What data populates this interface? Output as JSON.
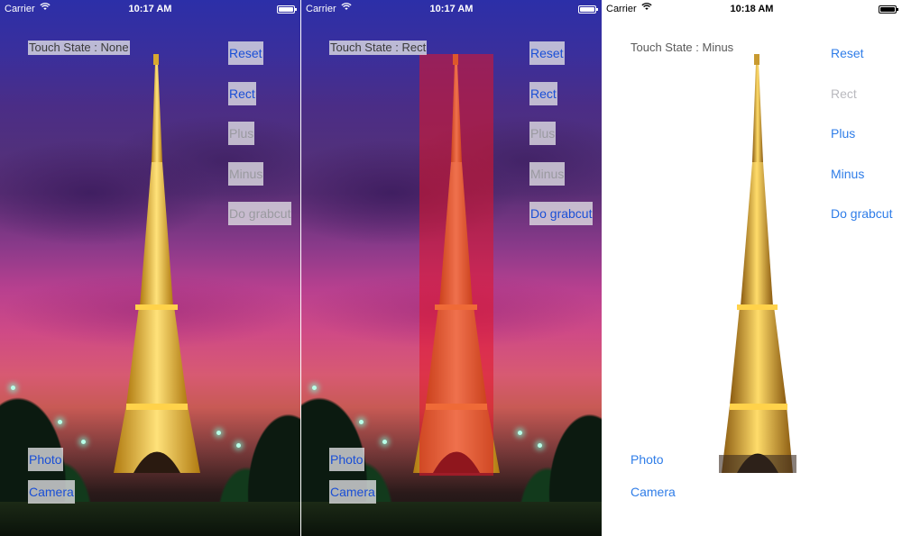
{
  "screens": [
    {
      "status": {
        "carrier": "Carrier",
        "time": "10:17 AM"
      },
      "touch_state": "Touch State : None",
      "buttons": {
        "reset": "Reset",
        "rect": "Rect",
        "plus": "Plus",
        "minus": "Minus",
        "grabcut": "Do grabcut",
        "photo": "Photo",
        "camera": "Camera"
      }
    },
    {
      "status": {
        "carrier": "Carrier",
        "time": "10:17 AM"
      },
      "touch_state": "Touch State : Rect",
      "buttons": {
        "reset": "Reset",
        "rect": "Rect",
        "plus": "Plus",
        "minus": "Minus",
        "grabcut": "Do grabcut",
        "photo": "Photo",
        "camera": "Camera"
      }
    },
    {
      "status": {
        "carrier": "Carrier",
        "time": "10:18 AM"
      },
      "touch_state": "Touch State : Minus",
      "buttons": {
        "reset": "Reset",
        "rect": "Rect",
        "plus": "Plus",
        "minus": "Minus",
        "grabcut": "Do grabcut",
        "photo": "Photo",
        "camera": "Camera"
      }
    }
  ],
  "icons": {
    "wifi": "wifi-icon",
    "battery": "battery-icon"
  },
  "colors": {
    "button_blue": "#2f7de8",
    "disabled_gray": "#9a9aa0",
    "selection_red": "#e11428"
  }
}
